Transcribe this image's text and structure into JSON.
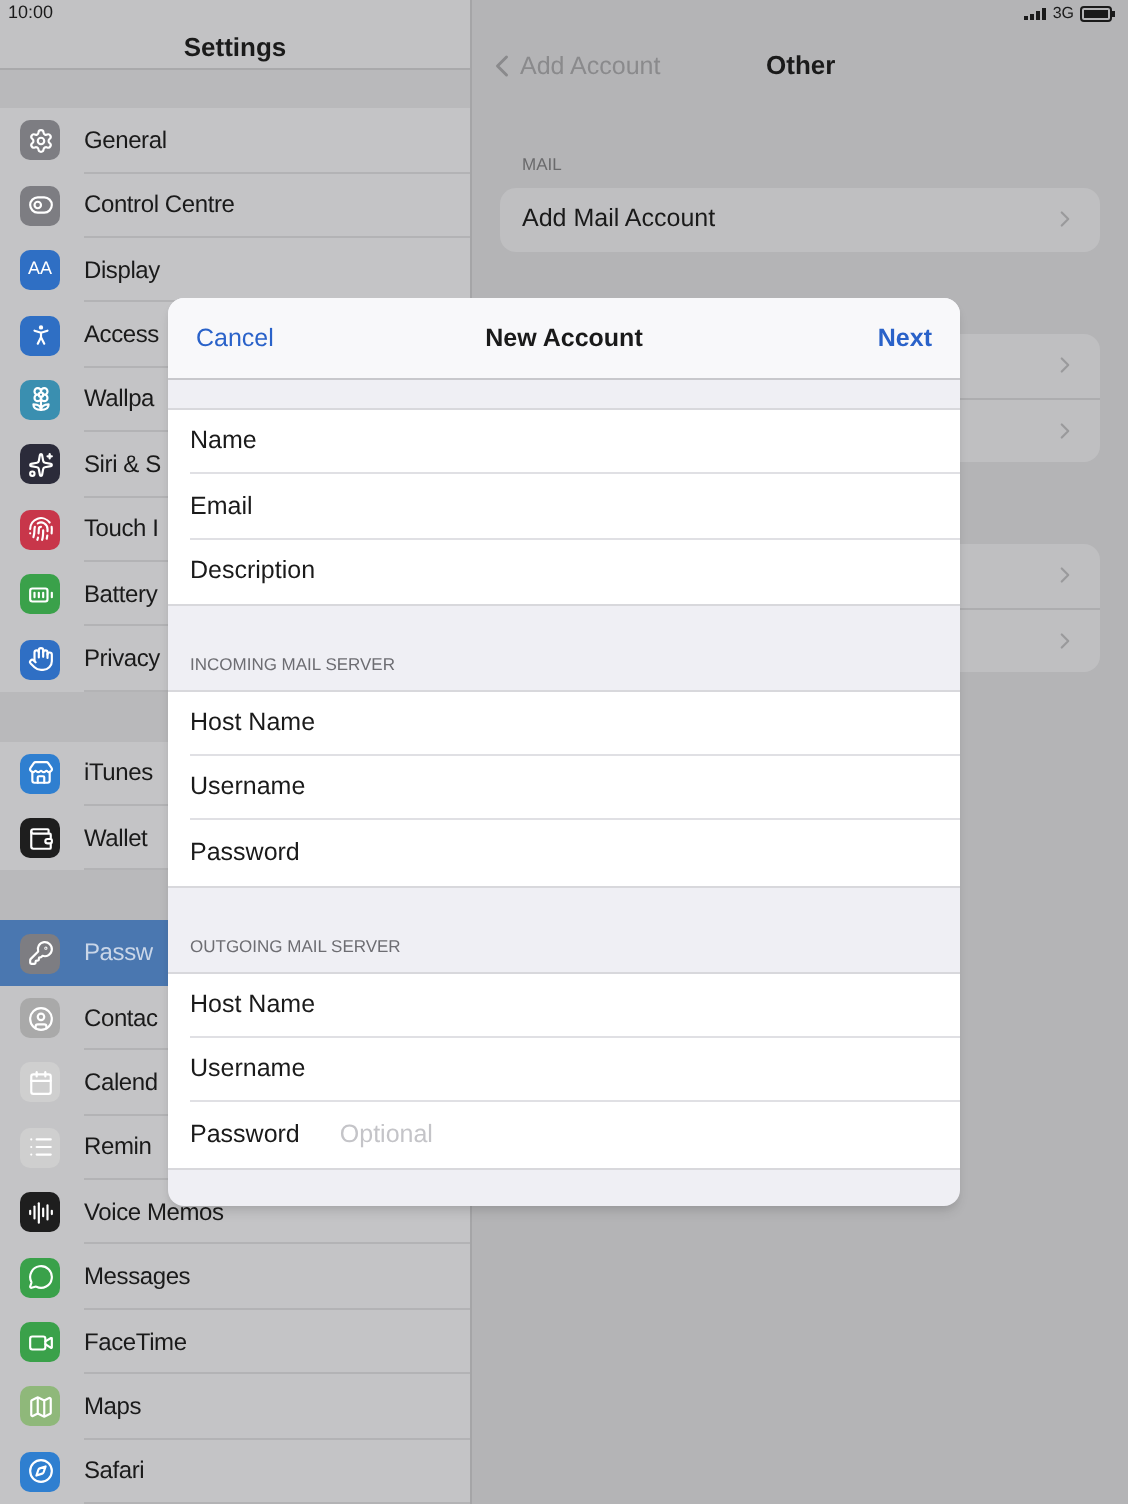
{
  "status_bar": {
    "time": "10:00",
    "network": "3G"
  },
  "sidebar": {
    "title": "Settings",
    "groups": [
      [
        {
          "label": "General",
          "kind": "gear",
          "color": "#7d7d82",
          "selected": false
        },
        {
          "label": "Control Centre",
          "kind": "toggles",
          "color": "#7d7d82",
          "selected": false
        },
        {
          "label": "Display",
          "kind": "text",
          "glyph": "AA",
          "color": "#2f6fc4",
          "selected": false
        },
        {
          "label": "Access",
          "kind": "person",
          "color": "#2f6fc4",
          "selected": false
        },
        {
          "label": "Wallpa",
          "kind": "flower",
          "color": "#3a8fb0",
          "selected": false
        },
        {
          "label": "Siri & S",
          "kind": "siri",
          "color": "#2b2b3a",
          "selected": false
        },
        {
          "label": "Touch I",
          "kind": "fingerprint",
          "color": "#c8364a",
          "selected": false
        },
        {
          "label": "Battery",
          "kind": "battery",
          "color": "#3aa14a",
          "selected": false
        },
        {
          "label": "Privacy",
          "kind": "hand",
          "color": "#2f6fc4",
          "selected": false
        }
      ],
      [
        {
          "label": "iTunes",
          "kind": "store",
          "color": "#2f7fd0",
          "selected": false
        },
        {
          "label": "Wallet",
          "kind": "wallet",
          "color": "#1e1e1e",
          "selected": false
        }
      ],
      [
        {
          "label": "Passw",
          "kind": "key",
          "color": "#7d7d82",
          "selected": true
        },
        {
          "label": "Contac",
          "kind": "contact",
          "color": "#a9a9a9",
          "selected": false
        },
        {
          "label": "Calend",
          "kind": "calendar",
          "color": "#cfcfcf",
          "selected": false
        },
        {
          "label": "Remin",
          "kind": "list",
          "color": "#cfcfcf",
          "selected": false
        },
        {
          "label": "Voice Memos",
          "kind": "wave",
          "color": "#1e1e1e",
          "selected": false
        },
        {
          "label": "Messages",
          "kind": "message",
          "color": "#3aa14a",
          "selected": false
        },
        {
          "label": "FaceTime",
          "kind": "video",
          "color": "#3aa14a",
          "selected": false
        },
        {
          "label": "Maps",
          "kind": "map",
          "color": "#8fb87a",
          "selected": false
        },
        {
          "label": "Safari",
          "kind": "compass",
          "color": "#2f7fd0",
          "selected": false
        }
      ]
    ]
  },
  "detail": {
    "back": "Add Account",
    "title": "Other",
    "section_header": "MAIL",
    "row": "Add Mail Account",
    "hidden_groups": [
      {
        "rows": [
          {
            "kind": "chevron"
          },
          {
            "kind": "chevron"
          }
        ]
      },
      {
        "rows": [
          {
            "kind": "chevron"
          },
          {
            "kind": "chevron"
          }
        ]
      }
    ]
  },
  "modal": {
    "cancel": "Cancel",
    "title": "New Account",
    "next": "Next",
    "sections": [
      {
        "rows": [
          {
            "label": "Name"
          },
          {
            "label": "Email"
          },
          {
            "label": "Description"
          }
        ]
      },
      {
        "header": "INCOMING MAIL SERVER",
        "rows": [
          {
            "label": "Host Name"
          },
          {
            "label": "Username"
          },
          {
            "label": "Password"
          }
        ]
      },
      {
        "header": "OUTGOING MAIL SERVER",
        "rows": [
          {
            "label": "Host Name"
          },
          {
            "label": "Username"
          },
          {
            "label": "Password",
            "placeholder": "Optional"
          }
        ]
      }
    ]
  }
}
